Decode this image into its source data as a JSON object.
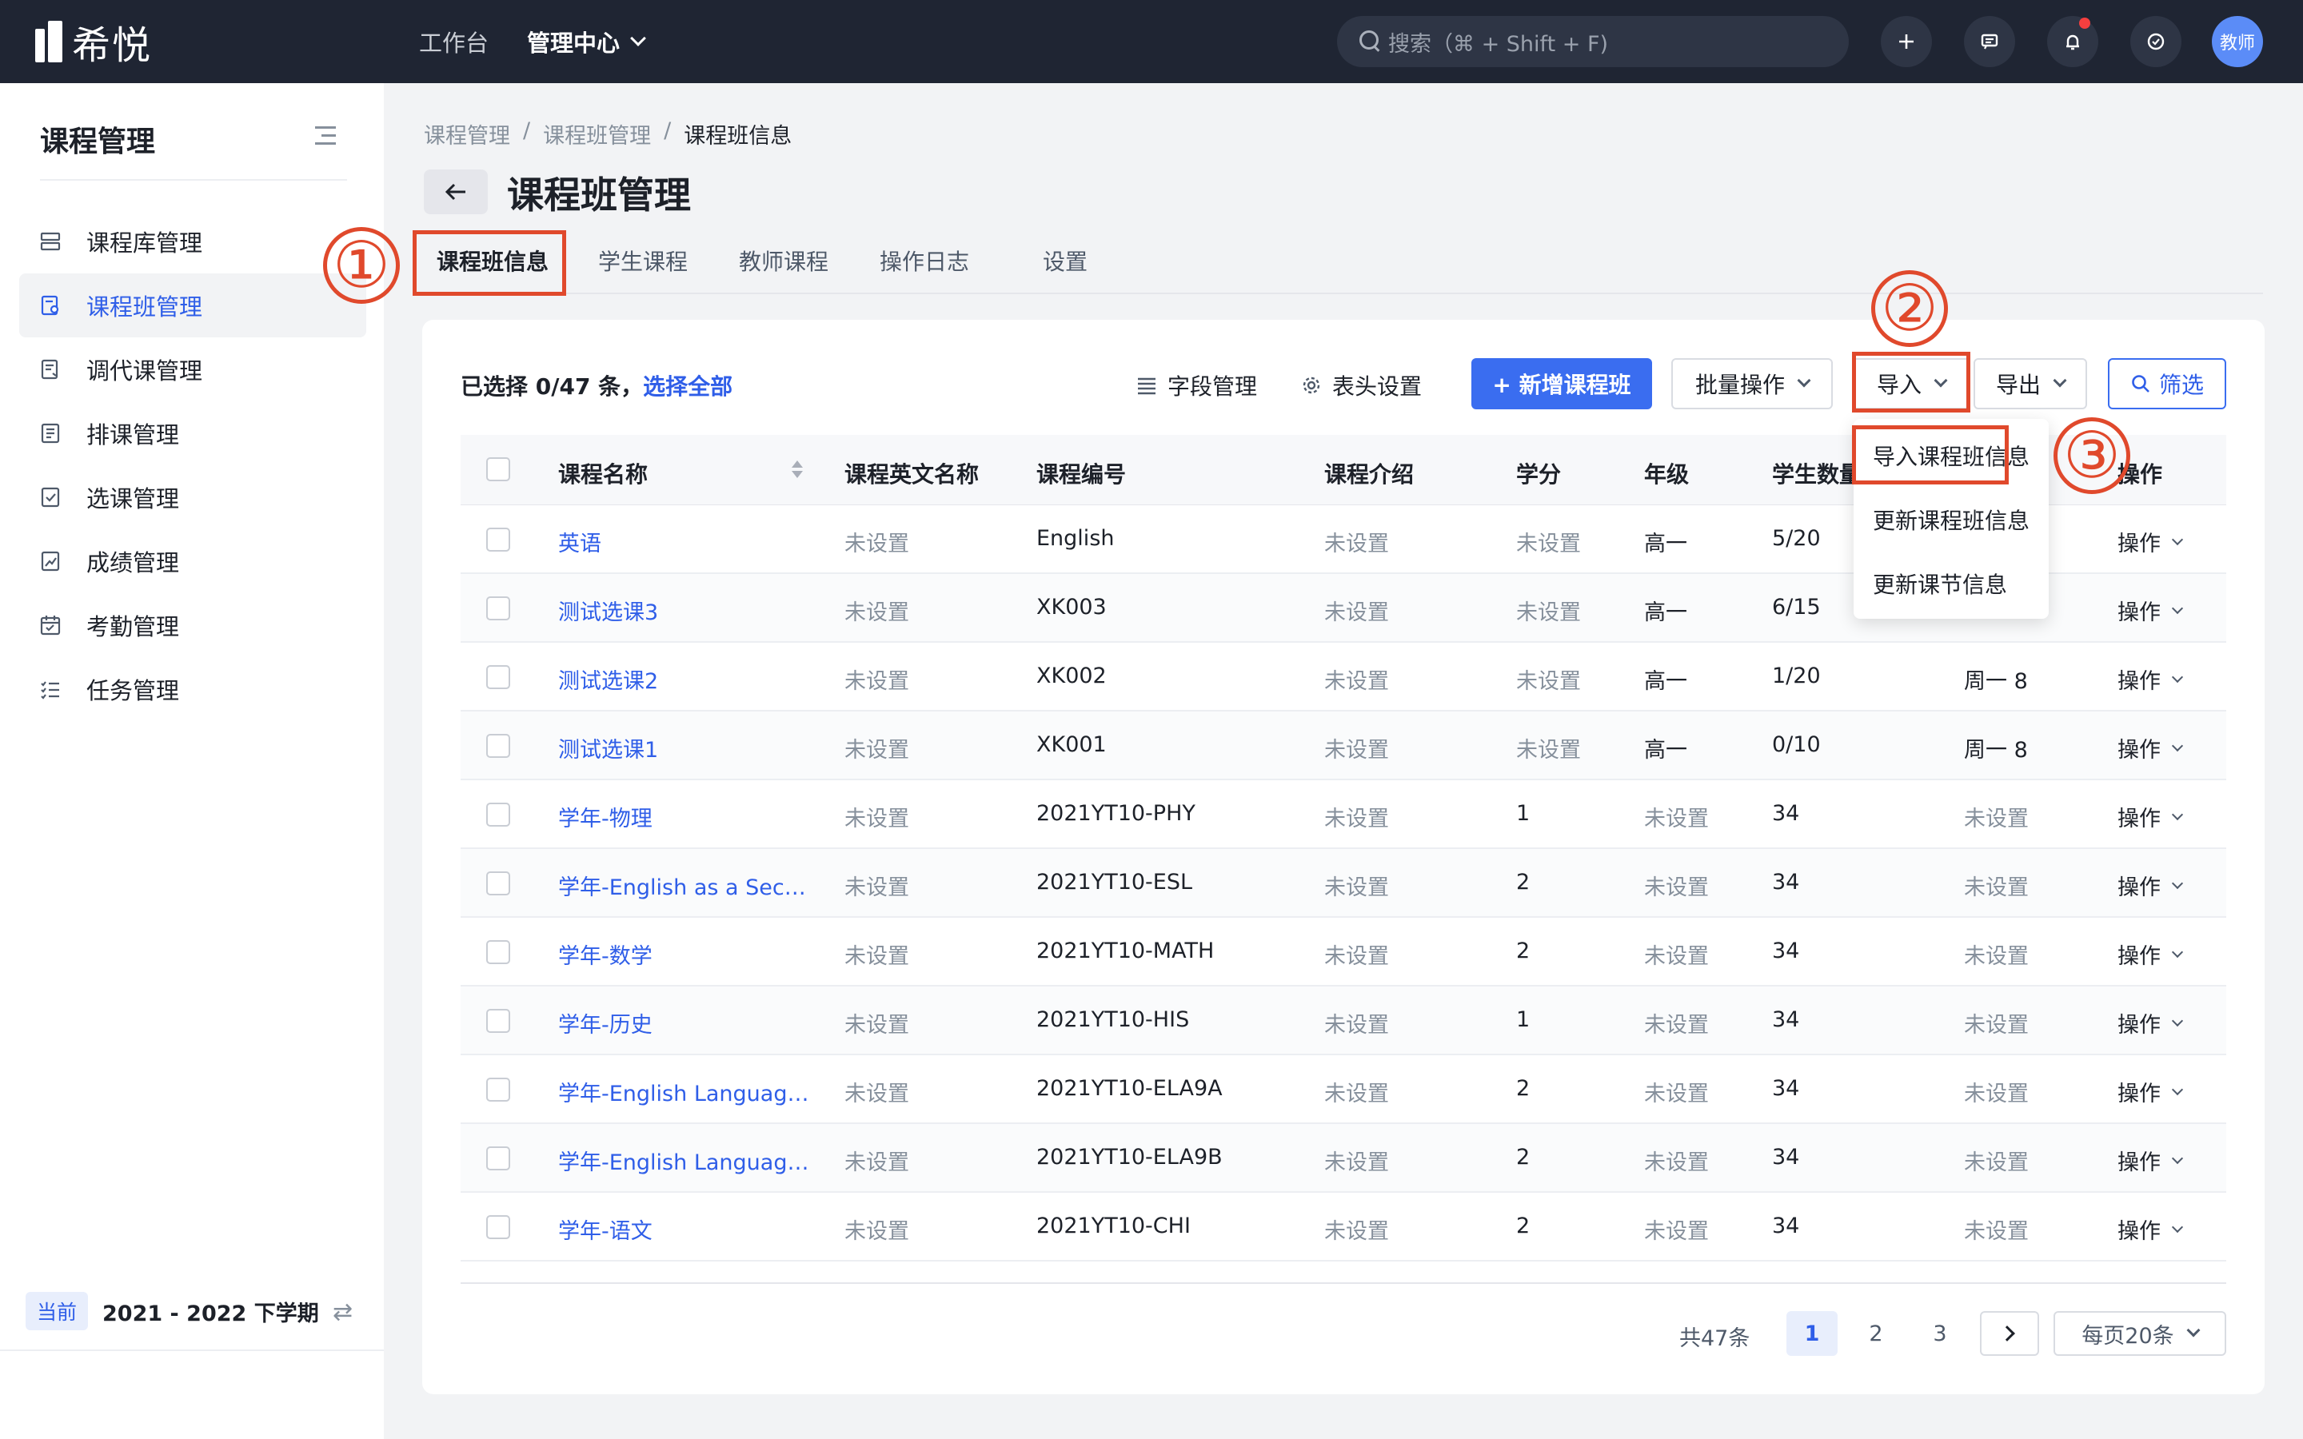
{
  "app": {
    "logo_text": "希悦",
    "nav": [
      {
        "label": "工作台",
        "active": false
      },
      {
        "label": "管理中心",
        "active": true
      }
    ],
    "search_placeholder": "搜索（⌘ + Shift + F)",
    "avatar_text": "教师",
    "icons": [
      "plus-icon",
      "message-icon",
      "bell-icon",
      "help-icon"
    ]
  },
  "sidebar": {
    "title": "课程管理",
    "items": [
      {
        "label": "课程库管理",
        "icon": "library-icon",
        "active": false
      },
      {
        "label": "课程班管理",
        "icon": "class-icon",
        "active": true
      },
      {
        "label": "调代课管理",
        "icon": "swap-icon",
        "active": false
      },
      {
        "label": "排课管理",
        "icon": "schedule-icon",
        "active": false
      },
      {
        "label": "选课管理",
        "icon": "select-icon",
        "active": false
      },
      {
        "label": "成绩管理",
        "icon": "grade-icon",
        "active": false
      },
      {
        "label": "考勤管理",
        "icon": "calendar-icon",
        "active": false
      },
      {
        "label": "任务管理",
        "icon": "task-icon",
        "active": false
      }
    ],
    "term_tag": "当前",
    "term": "2021 - 2022 下学期"
  },
  "breadcrumb": [
    "课程管理",
    "课程班管理",
    "课程班信息"
  ],
  "page_title": "课程班管理",
  "tabs": [
    "课程班信息",
    "学生课程",
    "教师课程",
    "操作日志",
    "设置"
  ],
  "toolbar": {
    "selected_prefix": "已选择 0/47 条，",
    "select_all": "选择全部",
    "field_manage": "字段管理",
    "header_settings": "表头设置",
    "add_class": "+ 新增课程班",
    "batch_ops": "批量操作",
    "import": "导入",
    "export": "导出",
    "filter": "筛选"
  },
  "import_menu": [
    "导入课程班信息",
    "更新课程班信息",
    "更新课节信息"
  ],
  "table": {
    "columns": [
      "课程名称",
      "课程英文名称",
      "课程编号",
      "课程介绍",
      "学分",
      "年级",
      "学生数量",
      "",
      "操作"
    ],
    "rows": [
      [
        "英语",
        "未设置",
        "English",
        "未设置",
        "未设置",
        "高一",
        "5/20",
        "",
        "操作"
      ],
      [
        "测试选课3",
        "未设置",
        "XK003",
        "未设置",
        "未设置",
        "高一",
        "6/15",
        "",
        "操作"
      ],
      [
        "测试选课2",
        "未设置",
        "XK002",
        "未设置",
        "未设置",
        "高一",
        "1/20",
        "周一 8",
        "操作"
      ],
      [
        "测试选课1",
        "未设置",
        "XK001",
        "未设置",
        "未设置",
        "高一",
        "0/10",
        "周一 8",
        "操作"
      ],
      [
        "学年-物理",
        "未设置",
        "2021YT10-PHY",
        "未设置",
        "1",
        "未设置",
        "34",
        "未设置",
        "操作"
      ],
      [
        "学年-English as a Sec…",
        "未设置",
        "2021YT10-ESL",
        "未设置",
        "2",
        "未设置",
        "34",
        "未设置",
        "操作"
      ],
      [
        "学年-数学",
        "未设置",
        "2021YT10-MATH",
        "未设置",
        "2",
        "未设置",
        "34",
        "未设置",
        "操作"
      ],
      [
        "学年-历史",
        "未设置",
        "2021YT10-HIS",
        "未设置",
        "1",
        "未设置",
        "34",
        "未设置",
        "操作"
      ],
      [
        "学年-English Languag…",
        "未设置",
        "2021YT10-ELA9A",
        "未设置",
        "2",
        "未设置",
        "34",
        "未设置",
        "操作"
      ],
      [
        "学年-English Languag…",
        "未设置",
        "2021YT10-ELA9B",
        "未设置",
        "2",
        "未设置",
        "34",
        "未设置",
        "操作"
      ],
      [
        "学年-语文",
        "未设置",
        "2021YT10-CHI",
        "未设置",
        "2",
        "未设置",
        "34",
        "未设置",
        "操作"
      ]
    ]
  },
  "pagination": {
    "total": "共47条",
    "pages": [
      "1",
      "2",
      "3"
    ],
    "current": "1",
    "page_size": "每页20条"
  },
  "annotations": [
    "①",
    "②",
    "③"
  ]
}
